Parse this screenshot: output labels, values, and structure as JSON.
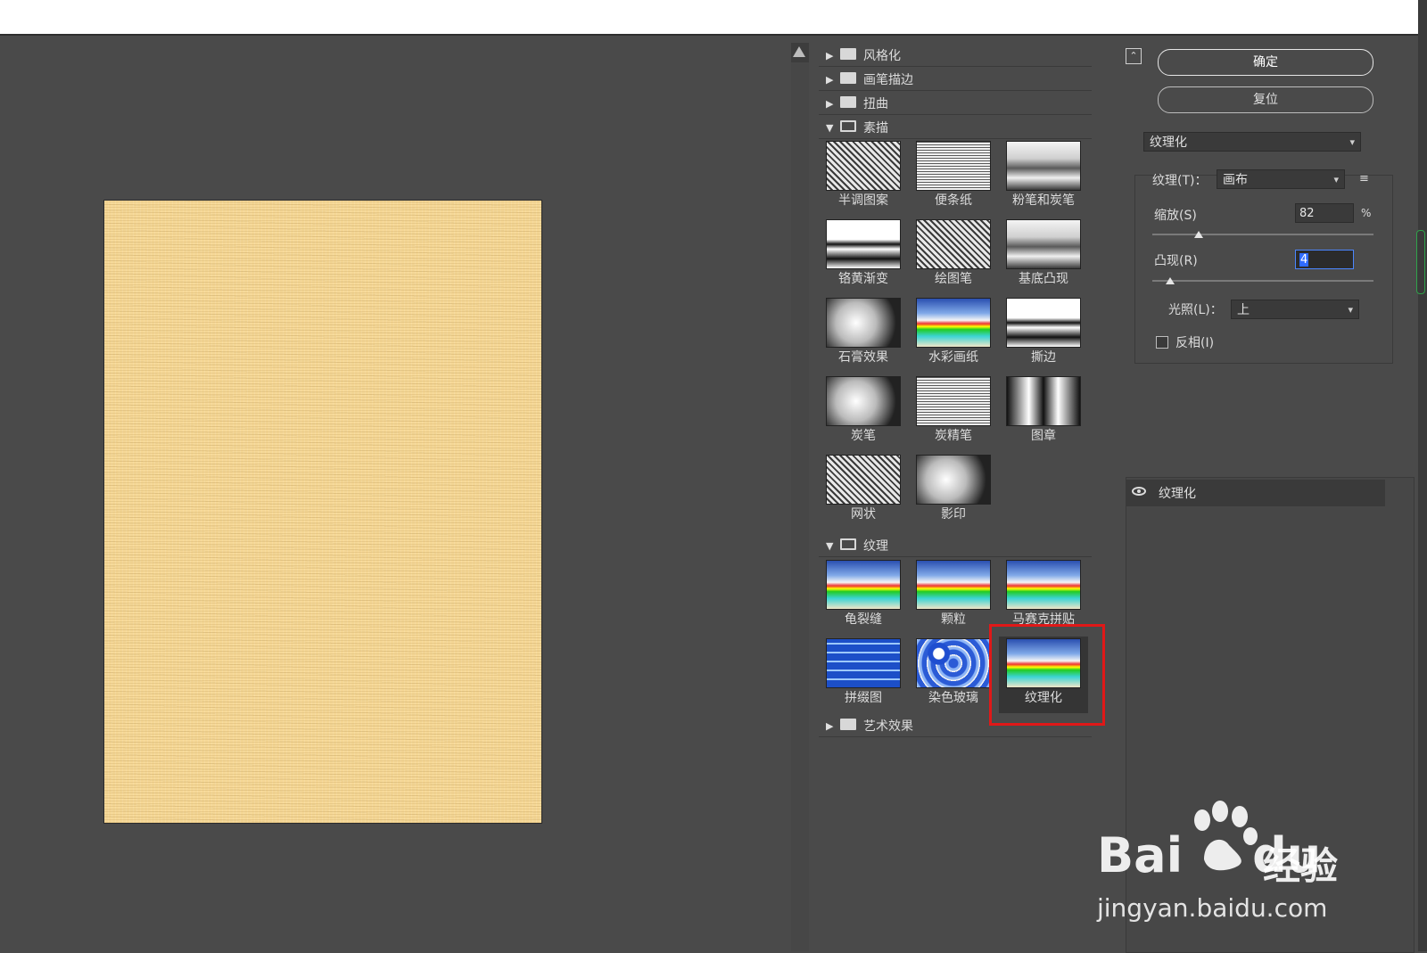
{
  "gallery": {
    "categories": [
      {
        "label": "风格化",
        "expanded": false
      },
      {
        "label": "画笔描边",
        "expanded": false
      },
      {
        "label": "扭曲",
        "expanded": false
      },
      {
        "label": "素描",
        "expanded": true
      },
      {
        "label": "纹理",
        "expanded": true
      },
      {
        "label": "艺术效果",
        "expanded": false
      }
    ],
    "sketch_filters": [
      "半调图案",
      "便条纸",
      "粉笔和炭笔",
      "铬黄渐变",
      "绘图笔",
      "基底凸现",
      "石膏效果",
      "水彩画纸",
      "撕边",
      "炭笔",
      "炭精笔",
      "图章",
      "网状",
      "影印"
    ],
    "texture_filters": [
      "龟裂缝",
      "颗粒",
      "马赛克拼贴",
      "拼缀图",
      "染色玻璃",
      "纹理化"
    ],
    "selected_filter": "纹理化",
    "arrow_expanded": "▼",
    "arrow_collapsed": "▶"
  },
  "settings": {
    "ok_label": "确定",
    "reset_label": "复位",
    "filter_select": "纹理化",
    "texture_label": "纹理(T)：",
    "texture_value": "画布",
    "scale_label": "缩放(S)",
    "scale_value": "82",
    "scale_unit": "%",
    "scale_fraction": 0.21,
    "relief_label": "凸现(R)",
    "relief_value": "4",
    "relief_fraction": 0.08,
    "light_label": "光照(L)：",
    "light_value": "上",
    "invert_label": "反相(I)",
    "invert_checked": false
  },
  "layers": {
    "items": [
      {
        "label": "纹理化",
        "visible": true
      }
    ]
  },
  "watermark": {
    "brand": "Bai",
    "brand2": "du",
    "title": "经验",
    "url": "jingyan.baidu.com"
  },
  "icons": {
    "collapse": "collapse-up-icon",
    "menu": "panel-menu-icon",
    "eye": "eye-icon",
    "chevron": "chevron-down-icon",
    "folder": "folder-icon"
  }
}
